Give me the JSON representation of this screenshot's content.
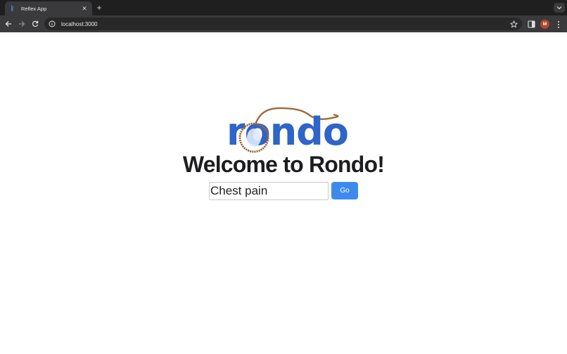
{
  "browser": {
    "tab": {
      "title": "Reflex App"
    },
    "address_bar": {
      "url": "localhost:3000"
    },
    "profile_initial": "M"
  },
  "app": {
    "logo_text": "rondo",
    "title": "Welcome to Rondo!",
    "search": {
      "value": "Chest pain"
    },
    "go_label": "Go"
  },
  "colors": {
    "accent": "#3d8aef",
    "logo_blue": "#2f64c8",
    "rope": "#9a6a3a",
    "chrome_dark": "#1f1f1f",
    "chrome_toolbar": "#3a3a3c"
  }
}
